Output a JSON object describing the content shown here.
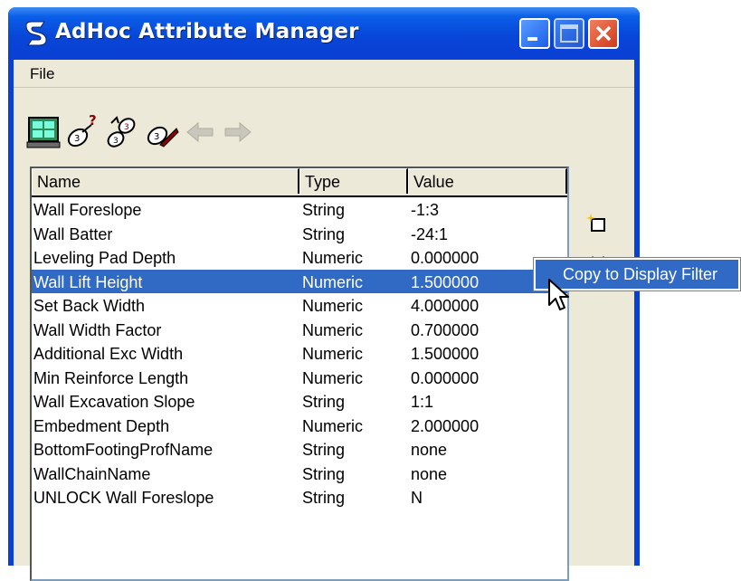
{
  "window": {
    "title": "AdHoc Attribute Manager",
    "controls": [
      "minimize",
      "maximize",
      "close"
    ]
  },
  "menubar": {
    "items": [
      "File"
    ]
  },
  "toolbar": {
    "icons": [
      "display-window-icon",
      "attribute-query-icon",
      "attribute-copy-icon",
      "attribute-edit-icon",
      "back-arrow-icon",
      "forward-arrow-icon"
    ]
  },
  "list": {
    "columns": [
      "Name",
      "Type",
      "Value"
    ],
    "rows": [
      {
        "name": "Wall Foreslope",
        "type": "String",
        "value": "-1:3"
      },
      {
        "name": "Wall Batter",
        "type": "String",
        "value": "-24:1"
      },
      {
        "name": "Leveling Pad Depth",
        "type": "Numeric",
        "value": "0.000000"
      },
      {
        "name": "Wall Lift Height",
        "type": "Numeric",
        "value": "1.500000"
      },
      {
        "name": "Set Back Width",
        "type": "Numeric",
        "value": "4.000000"
      },
      {
        "name": "Wall Width Factor",
        "type": "Numeric",
        "value": "0.700000"
      },
      {
        "name": "Additional Exc Width",
        "type": "Numeric",
        "value": "1.500000"
      },
      {
        "name": "Min Reinforce Length",
        "type": "Numeric",
        "value": "0.000000"
      },
      {
        "name": "Wall Excavation Slope",
        "type": "String",
        "value": "1:1"
      },
      {
        "name": "Embedment Depth",
        "type": "Numeric",
        "value": "2.000000"
      },
      {
        "name": "BottomFootingProfName",
        "type": "String",
        "value": "none"
      },
      {
        "name": "WallChainName",
        "type": "String",
        "value": "none"
      },
      {
        "name": "UNLOCK Wall Foreslope",
        "type": "String",
        "value": "N"
      }
    ],
    "selected_row": "Wall Lift Height"
  },
  "side_icons": [
    "new-attribute-icon",
    "delete-attribute-icon"
  ],
  "context_menu": {
    "items": [
      "Copy to Display Filter"
    ]
  },
  "colors": {
    "titlebar": "#0a5ee8",
    "selection": "#316ac5",
    "client_bg": "#ece9d8"
  }
}
